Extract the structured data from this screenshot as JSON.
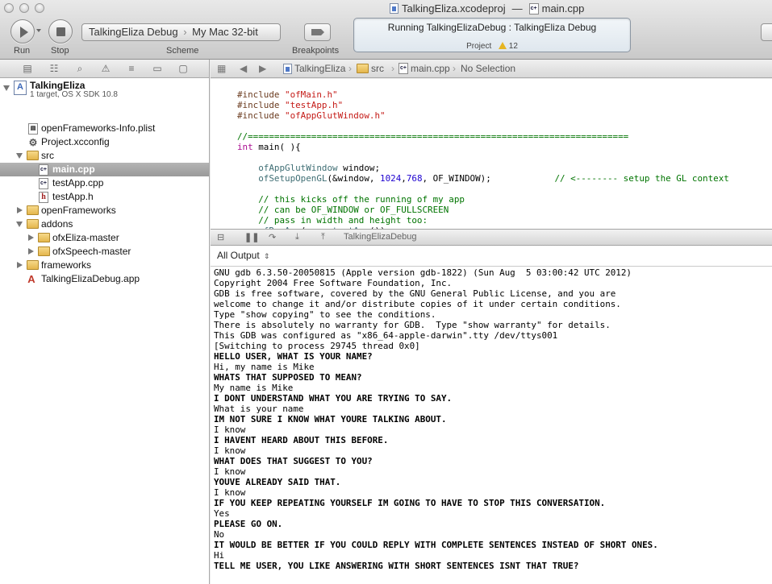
{
  "window": {
    "project_file": "TalkingEliza.xcodeproj",
    "separator": "—",
    "current_file": "main.cpp"
  },
  "toolbar": {
    "run_label": "Run",
    "stop_label": "Stop",
    "scheme_label": "Scheme",
    "breakpoints_label": "Breakpoints",
    "scheme_target": "TalkingEliza Debug",
    "scheme_destination": "My Mac 32-bit",
    "activity_status": "Running TalkingElizaDebug : TalkingEliza Debug",
    "activity_project": "Project",
    "warning_count": "12"
  },
  "navigator": {
    "project": {
      "name": "TalkingEliza",
      "detail": "1 target, OS X SDK 10.8"
    },
    "items": [
      {
        "label": "openFrameworks-Info.plist"
      },
      {
        "label": "Project.xcconfig"
      },
      {
        "label": "src"
      },
      {
        "label": "main.cpp"
      },
      {
        "label": "testApp.cpp"
      },
      {
        "label": "testApp.h"
      },
      {
        "label": "openFrameworks"
      },
      {
        "label": "addons"
      },
      {
        "label": "ofxEliza-master"
      },
      {
        "label": "ofxSpeech-master"
      },
      {
        "label": "frameworks"
      },
      {
        "label": "TalkingElizaDebug.app"
      }
    ]
  },
  "jumpbar": {
    "project": "TalkingEliza",
    "folder": "src",
    "file": "main.cpp",
    "selection": "No Selection"
  },
  "editor": {
    "lines": [
      "#include \"ofMain.h\"",
      "#include \"testApp.h\"",
      "#include \"ofAppGlutWindow.h\"",
      "",
      "//========================================================================",
      "int main( ){",
      "",
      "    ofAppGlutWindow window;",
      "    ofSetupOpenGL(&window, 1024,768, OF_WINDOW);            // <-------- setup the GL context",
      "",
      "    // this kicks off the running of my app",
      "    // can be OF_WINDOW or OF_FULLSCREEN",
      "    // pass in width and height too:",
      "    ofRunApp( new testApp());"
    ]
  },
  "debug": {
    "target": "TalkingElizaDebug",
    "output_filter": "All Output"
  },
  "console": {
    "lines": [
      {
        "text": "GNU gdb 6.3.50-20050815 (Apple version gdb-1822) (Sun Aug  5 03:00:42 UTC 2012)",
        "bold": false
      },
      {
        "text": "Copyright 2004 Free Software Foundation, Inc.",
        "bold": false
      },
      {
        "text": "GDB is free software, covered by the GNU General Public License, and you are",
        "bold": false
      },
      {
        "text": "welcome to change it and/or distribute copies of it under certain conditions.",
        "bold": false
      },
      {
        "text": "Type \"show copying\" to see the conditions.",
        "bold": false
      },
      {
        "text": "There is absolutely no warranty for GDB.  Type \"show warranty\" for details.",
        "bold": false
      },
      {
        "text": "This GDB was configured as \"x86_64-apple-darwin\".tty /dev/ttys001",
        "bold": false
      },
      {
        "text": "[Switching to process 29745 thread 0x0]",
        "bold": false
      },
      {
        "text": "HELLO USER, WHAT IS YOUR NAME?",
        "bold": true
      },
      {
        "text": "Hi, my name is Mike",
        "bold": false
      },
      {
        "text": "WHATS THAT SUPPOSED TO MEAN?",
        "bold": true
      },
      {
        "text": "My name is Mike",
        "bold": false
      },
      {
        "text": "I DONT UNDERSTAND WHAT YOU ARE TRYING TO SAY.",
        "bold": true
      },
      {
        "text": "What is your name",
        "bold": false
      },
      {
        "text": "IM NOT SURE I KNOW WHAT YOURE TALKING ABOUT.",
        "bold": true
      },
      {
        "text": "I know",
        "bold": false
      },
      {
        "text": "I HAVENT HEARD ABOUT THIS BEFORE.",
        "bold": true
      },
      {
        "text": "I know",
        "bold": false
      },
      {
        "text": "WHAT DOES THAT SUGGEST TO YOU?",
        "bold": true
      },
      {
        "text": "I know",
        "bold": false
      },
      {
        "text": "YOUVE ALREADY SAID THAT.",
        "bold": true
      },
      {
        "text": "I know",
        "bold": false
      },
      {
        "text": "IF YOU KEEP REPEATING YOURSELF IM GOING TO HAVE TO STOP THIS CONVERSATION.",
        "bold": true
      },
      {
        "text": "Yes",
        "bold": false
      },
      {
        "text": "PLEASE GO ON.",
        "bold": true
      },
      {
        "text": "No",
        "bold": false
      },
      {
        "text": "IT WOULD BE BETTER IF YOU COULD REPLY WITH COMPLETE SENTENCES INSTEAD OF SHORT ONES.",
        "bold": true
      },
      {
        "text": "Hi",
        "bold": false
      },
      {
        "text": "TELL ME USER, YOU LIKE ANSWERING WITH SHORT SENTENCES ISNT THAT TRUE?",
        "bold": true
      }
    ]
  },
  "colors": {
    "keyword": "#aa0d91",
    "string": "#c41a16",
    "comment": "#007400",
    "number": "#1c00cf",
    "preprocessor": "#6b3b1f",
    "selection": "#a8a8a8",
    "warning": "#e6b522"
  }
}
